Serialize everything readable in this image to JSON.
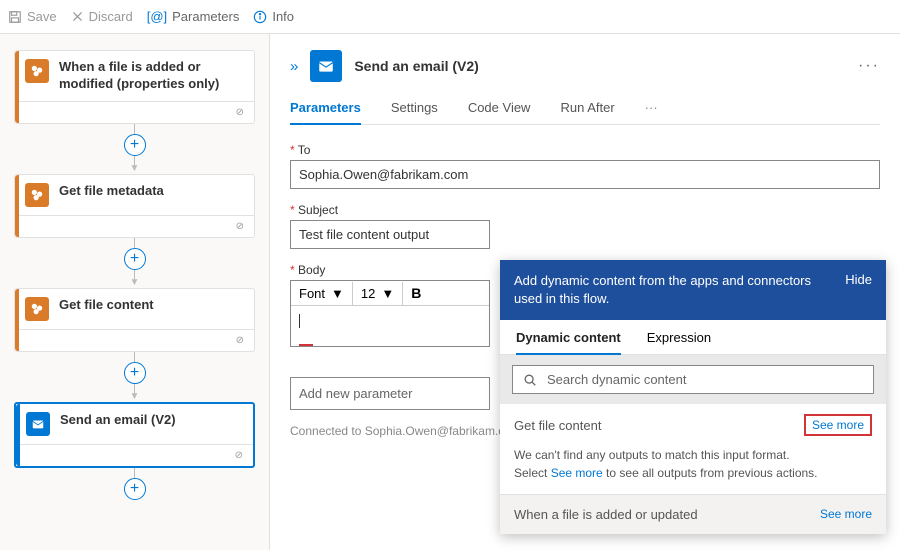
{
  "toolbar": {
    "save": "Save",
    "discard": "Discard",
    "parameters": "Parameters",
    "info": "Info"
  },
  "flow": {
    "step1": "When a file is added or modified (properties only)",
    "step2": "Get file metadata",
    "step3": "Get file content",
    "step4": "Send an email (V2)"
  },
  "panel": {
    "title": "Send an email (V2)",
    "tabs": {
      "parameters": "Parameters",
      "settings": "Settings",
      "codeview": "Code View",
      "runafter": "Run After"
    },
    "to_label": "To",
    "to_value": "Sophia.Owen@fabrikam.com",
    "subject_label": "Subject",
    "subject_value": "Test file content output",
    "body_label": "Body",
    "font_label": "Font",
    "font_size": "12",
    "add_param": "Add new parameter",
    "connected_prefix": "Connected to",
    "connected_value": "Sophia.Owen@fabrikam.com"
  },
  "popup": {
    "banner": "Add dynamic content from the apps and connectors used in this flow.",
    "hide": "Hide",
    "tab_dc": "Dynamic content",
    "tab_expr": "Expression",
    "search_placeholder": "Search dynamic content",
    "sec1": "Get file content",
    "see_more": "See more",
    "info1": "We can't find any outputs to match this input format.",
    "info2a": "Select ",
    "info2b": "See more",
    "info2c": " to see all outputs from previous actions.",
    "sec2": "When a file is added or updated"
  }
}
